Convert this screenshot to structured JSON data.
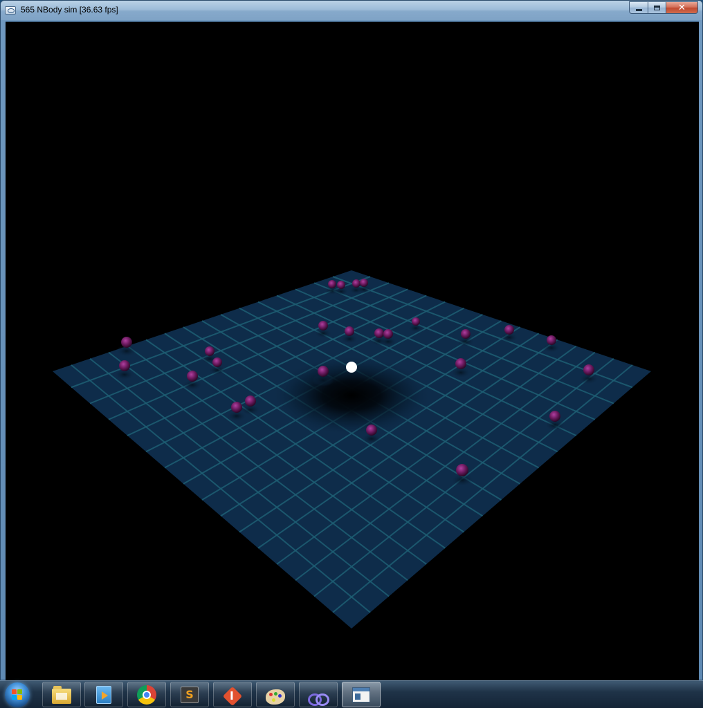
{
  "window": {
    "title": "565 NBody sim [36.63 fps]",
    "caption_buttons": {
      "minimize_icon": "minimize-icon",
      "maximize_icon": "maximize-icon",
      "close_glyph": "✕"
    }
  },
  "scene": {
    "background": "#000000",
    "grid_color": "#1e5f74",
    "surface_color": "#0f2f4f",
    "planet_color": "#7a1f6a",
    "star_color": "#ffffff"
  },
  "taskbar": {
    "start_icon": "windows-start-icon",
    "apps": [
      {
        "name": "windows-explorer",
        "icon": "folder-icon",
        "active": false
      },
      {
        "name": "media-player",
        "icon": "media-player-icon",
        "active": false
      },
      {
        "name": "google-chrome",
        "icon": "chrome-icon",
        "active": false
      },
      {
        "name": "sublime-text",
        "icon": "sublime-text-icon",
        "glyph": "S",
        "active": false
      },
      {
        "name": "git",
        "icon": "git-icon",
        "active": false
      },
      {
        "name": "paint",
        "icon": "paint-palette-icon",
        "active": false
      },
      {
        "name": "visual-studio",
        "icon": "visual-studio-icon",
        "active": false
      },
      {
        "name": "nbody-sim-window",
        "icon": "application-window-icon",
        "active": true
      }
    ]
  }
}
